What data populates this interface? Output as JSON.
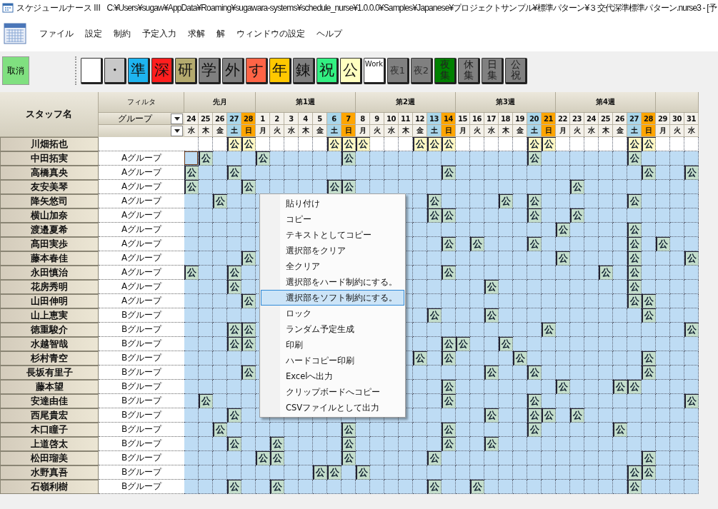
{
  "window": {
    "app_name": "スケジュールナース III",
    "file_path": "C:¥Users¥sugaw¥AppData¥Roaming¥sugawara-systems¥schedule_nurse¥1.0.0.0¥Samples¥Japanese¥プロジェクトサンプル¥標準パターン¥３交代深準標準パターン.nurse3 - [予"
  },
  "menu": [
    "ファイル",
    "設定",
    "制約",
    "予定入力",
    "求解",
    "解",
    "ウィンドウの設定",
    "ヘルプ"
  ],
  "toolbar": {
    "cancel": "取消",
    "palette": [
      {
        "kind": "single",
        "color": "#ffffff"
      },
      {
        "kind": "single",
        "label": "・",
        "color": "#c8c8c8"
      },
      {
        "kind": "single",
        "label": "準",
        "color": "#1eb4f0"
      },
      {
        "kind": "single",
        "label": "深",
        "color": "#ff1e1e"
      },
      {
        "kind": "single",
        "label": "研",
        "color": "#b4aa6e"
      },
      {
        "kind": "single",
        "label": "学",
        "color": "#808080"
      },
      {
        "kind": "single",
        "label": "外",
        "color": "#808080"
      },
      {
        "kind": "single",
        "label": "す",
        "color": "#ff6446"
      },
      {
        "kind": "single",
        "label": "年",
        "color": "#ffc800"
      },
      {
        "kind": "single",
        "label": "錬",
        "color": "#808080"
      },
      {
        "kind": "single",
        "label": "祝",
        "color": "#32f082"
      },
      {
        "kind": "single",
        "label": "公",
        "color": "#ffffc0"
      },
      {
        "kind": "small",
        "label": "Work",
        "color": "#ffffff"
      },
      {
        "kind": "medium",
        "label": "夜1",
        "color": "#808080"
      },
      {
        "kind": "medium",
        "label": "夜2",
        "color": "#808080"
      },
      {
        "kind": "stacked",
        "label": "夜集",
        "color": "#008000"
      },
      {
        "kind": "stacked",
        "label": "休集",
        "color": "#808080"
      },
      {
        "kind": "stacked",
        "label": "日集",
        "color": "#808080"
      },
      {
        "kind": "stacked",
        "label": "公祝",
        "color": "#808080"
      }
    ]
  },
  "grid": {
    "staff_header": "スタッフ名",
    "filter_header": "フィルタ",
    "group_filter": "グループ",
    "weeks": [
      {
        "label": "先月",
        "days": [
          {
            "date": "24",
            "weekday": "水",
            "kind": "weekday"
          },
          {
            "date": "25",
            "weekday": "木",
            "kind": "weekday"
          },
          {
            "date": "26",
            "weekday": "金",
            "kind": "weekday"
          },
          {
            "date": "27",
            "weekday": "土",
            "kind": "saturday"
          },
          {
            "date": "28",
            "weekday": "日",
            "kind": "sunday"
          }
        ]
      },
      {
        "label": "第1週",
        "days": [
          {
            "date": "1",
            "weekday": "月",
            "kind": "weekday"
          },
          {
            "date": "2",
            "weekday": "火",
            "kind": "weekday"
          },
          {
            "date": "3",
            "weekday": "水",
            "kind": "weekday"
          },
          {
            "date": "4",
            "weekday": "木",
            "kind": "weekday"
          },
          {
            "date": "5",
            "weekday": "金",
            "kind": "weekday"
          },
          {
            "date": "6",
            "weekday": "土",
            "kind": "saturday"
          },
          {
            "date": "7",
            "weekday": "日",
            "kind": "sunday"
          }
        ]
      },
      {
        "label": "第2週",
        "days": [
          {
            "date": "8",
            "weekday": "月",
            "kind": "weekday"
          },
          {
            "date": "9",
            "weekday": "火",
            "kind": "weekday"
          },
          {
            "date": "10",
            "weekday": "水",
            "kind": "weekday"
          },
          {
            "date": "11",
            "weekday": "木",
            "kind": "weekday"
          },
          {
            "date": "12",
            "weekday": "金",
            "kind": "weekday"
          },
          {
            "date": "13",
            "weekday": "土",
            "kind": "saturday"
          },
          {
            "date": "14",
            "weekday": "日",
            "kind": "sunday"
          }
        ]
      },
      {
        "label": "第3週",
        "days": [
          {
            "date": "15",
            "weekday": "月",
            "kind": "weekday"
          },
          {
            "date": "16",
            "weekday": "火",
            "kind": "weekday"
          },
          {
            "date": "17",
            "weekday": "水",
            "kind": "weekday"
          },
          {
            "date": "18",
            "weekday": "木",
            "kind": "weekday"
          },
          {
            "date": "19",
            "weekday": "金",
            "kind": "weekday"
          },
          {
            "date": "20",
            "weekday": "土",
            "kind": "saturday"
          },
          {
            "date": "21",
            "weekday": "日",
            "kind": "sunday"
          }
        ]
      },
      {
        "label": "第4週",
        "days": [
          {
            "date": "22",
            "weekday": "月",
            "kind": "weekday"
          },
          {
            "date": "23",
            "weekday": "火",
            "kind": "weekday"
          },
          {
            "date": "24",
            "weekday": "水",
            "kind": "weekday"
          },
          {
            "date": "25",
            "weekday": "木",
            "kind": "weekday"
          },
          {
            "date": "26",
            "weekday": "金",
            "kind": "weekday"
          },
          {
            "date": "27",
            "weekday": "土",
            "kind": "saturday"
          },
          {
            "date": "28",
            "weekday": "日",
            "kind": "sunday"
          }
        ]
      },
      {
        "days": [
          {
            "date": "29",
            "weekday": "月",
            "kind": "weekday"
          },
          {
            "date": "30",
            "weekday": "火",
            "kind": "weekday"
          },
          {
            "date": "31",
            "weekday": "水",
            "kind": "weekday"
          }
        ]
      }
    ],
    "rows": [
      {
        "kind": "preset",
        "name": "川畑拓也",
        "cells": [
          null,
          null,
          null,
          "公",
          "公",
          null,
          null,
          null,
          null,
          null,
          "公",
          "公",
          "公",
          null,
          null,
          null,
          "公",
          "公",
          "公",
          null,
          null,
          null,
          null,
          null,
          "公",
          "公",
          null,
          null,
          null,
          null,
          null,
          "公",
          "公",
          null,
          null,
          null
        ]
      },
      {
        "kind": "staff",
        "name": "中田拓実",
        "group": "Aグループ",
        "cells": [
          {
            "selected": true
          },
          "公",
          null,
          null,
          null,
          "公",
          null,
          null,
          null,
          null,
          null,
          "公",
          null,
          null,
          null,
          null,
          null,
          null,
          null,
          null,
          null,
          null,
          null,
          null,
          "公",
          null,
          null,
          null,
          null,
          null,
          null,
          "公",
          null,
          null,
          null,
          null
        ]
      },
      {
        "kind": "staff",
        "name": "高橋真央",
        "group": "Aグループ",
        "cells": [
          "公",
          null,
          null,
          "公",
          null,
          null,
          null,
          null,
          null,
          null,
          null,
          null,
          null,
          null,
          null,
          null,
          null,
          null,
          "公",
          null,
          null,
          null,
          null,
          null,
          null,
          null,
          null,
          null,
          null,
          null,
          null,
          null,
          "公",
          null,
          null,
          "公"
        ]
      },
      {
        "kind": "staff",
        "name": "友安美琴",
        "group": "Aグループ",
        "cells": [
          "公",
          null,
          null,
          null,
          "公",
          null,
          null,
          null,
          null,
          null,
          "公",
          "公",
          null,
          null,
          null,
          null,
          null,
          null,
          null,
          null,
          null,
          null,
          null,
          null,
          null,
          null,
          null,
          "公",
          null,
          null,
          null,
          null,
          null,
          null,
          null,
          null
        ]
      },
      {
        "kind": "staff",
        "name": "降矢悠司",
        "group": "Aグループ",
        "cells": [
          null,
          null,
          "公",
          null,
          null,
          null,
          null,
          null,
          null,
          null,
          null,
          null,
          null,
          null,
          null,
          null,
          null,
          "公",
          null,
          null,
          null,
          null,
          "公",
          null,
          "公",
          null,
          null,
          null,
          null,
          null,
          null,
          "公",
          null,
          null,
          null,
          null
        ]
      },
      {
        "kind": "staff",
        "name": "横山加奈",
        "group": "Aグループ",
        "cells": [
          null,
          null,
          null,
          null,
          null,
          null,
          null,
          null,
          null,
          null,
          null,
          null,
          null,
          null,
          null,
          null,
          null,
          "公",
          "公",
          null,
          null,
          null,
          null,
          null,
          "公",
          null,
          null,
          "公",
          null,
          null,
          null,
          null,
          null,
          null,
          null,
          null
        ]
      },
      {
        "kind": "staff",
        "name": "渡邉夏希",
        "group": "Aグループ",
        "cells": [
          null,
          null,
          null,
          null,
          null,
          null,
          null,
          null,
          null,
          null,
          null,
          null,
          null,
          null,
          null,
          null,
          null,
          null,
          null,
          null,
          null,
          null,
          null,
          null,
          null,
          null,
          "公",
          null,
          null,
          null,
          null,
          "公",
          null,
          null,
          null,
          null
        ]
      },
      {
        "kind": "staff",
        "name": "髙田実歩",
        "group": "Aグループ",
        "cells": [
          null,
          null,
          null,
          null,
          null,
          null,
          null,
          null,
          null,
          null,
          null,
          null,
          null,
          null,
          null,
          null,
          null,
          null,
          "公",
          null,
          "公",
          null,
          null,
          null,
          "公",
          null,
          null,
          null,
          null,
          null,
          null,
          "公",
          null,
          "公",
          null,
          null
        ]
      },
      {
        "kind": "staff",
        "name": "藤本春佳",
        "group": "Aグループ",
        "cells": [
          null,
          null,
          null,
          null,
          "公",
          null,
          null,
          null,
          null,
          null,
          null,
          null,
          null,
          null,
          null,
          null,
          null,
          null,
          null,
          null,
          null,
          null,
          null,
          null,
          null,
          null,
          "公",
          null,
          null,
          null,
          null,
          "公",
          null,
          null,
          null,
          "公"
        ]
      },
      {
        "kind": "staff",
        "name": "永田慎治",
        "group": "Aグループ",
        "cells": [
          "公",
          null,
          null,
          "公",
          null,
          null,
          null,
          null,
          null,
          null,
          null,
          null,
          null,
          null,
          null,
          null,
          null,
          null,
          "公",
          null,
          null,
          null,
          null,
          null,
          null,
          null,
          null,
          null,
          null,
          "公",
          null,
          "公",
          null,
          null,
          null,
          null
        ]
      },
      {
        "kind": "staff",
        "name": "花房秀明",
        "group": "Aグループ",
        "cells": [
          null,
          null,
          null,
          "公",
          null,
          null,
          null,
          null,
          null,
          null,
          null,
          null,
          null,
          null,
          null,
          null,
          null,
          null,
          null,
          null,
          null,
          "公",
          null,
          null,
          null,
          null,
          null,
          null,
          null,
          null,
          null,
          "公",
          null,
          null,
          null,
          null
        ]
      },
      {
        "kind": "staff",
        "name": "山田伸明",
        "group": "Aグループ",
        "cells": [
          null,
          null,
          null,
          null,
          "公",
          null,
          null,
          null,
          null,
          null,
          null,
          null,
          null,
          null,
          null,
          null,
          null,
          null,
          null,
          null,
          null,
          null,
          null,
          null,
          null,
          null,
          null,
          null,
          null,
          null,
          null,
          "公",
          "公",
          null,
          null,
          null
        ]
      },
      {
        "kind": "staff",
        "name": "山上恵実",
        "group": "Bグループ",
        "cells": [
          null,
          null,
          null,
          null,
          null,
          null,
          null,
          null,
          null,
          null,
          null,
          null,
          null,
          null,
          null,
          null,
          null,
          "公",
          null,
          null,
          null,
          "公",
          null,
          null,
          null,
          null,
          null,
          null,
          null,
          null,
          null,
          null,
          "公",
          null,
          null,
          null
        ]
      },
      {
        "kind": "staff",
        "name": "徳重駿介",
        "group": "Bグループ",
        "cells": [
          null,
          null,
          null,
          "公",
          "公",
          null,
          null,
          null,
          null,
          null,
          null,
          null,
          null,
          null,
          null,
          null,
          null,
          null,
          null,
          null,
          null,
          null,
          null,
          null,
          null,
          "公",
          null,
          null,
          null,
          null,
          null,
          null,
          null,
          null,
          null,
          "公"
        ]
      },
      {
        "kind": "staff",
        "name": "水越智哉",
        "group": "Bグループ",
        "cells": [
          null,
          null,
          null,
          "公",
          "公",
          null,
          null,
          null,
          null,
          null,
          null,
          null,
          null,
          null,
          null,
          null,
          null,
          null,
          "公",
          "公",
          null,
          null,
          "公",
          null,
          null,
          null,
          null,
          null,
          null,
          null,
          null,
          null,
          null,
          null,
          null,
          null
        ]
      },
      {
        "kind": "staff",
        "name": "杉村青空",
        "group": "Bグループ",
        "cells": [
          null,
          null,
          null,
          null,
          null,
          null,
          null,
          null,
          null,
          null,
          null,
          null,
          null,
          null,
          null,
          null,
          "公",
          null,
          "公",
          null,
          null,
          null,
          null,
          "公",
          null,
          null,
          null,
          null,
          null,
          null,
          null,
          null,
          "公",
          null,
          null,
          null
        ]
      },
      {
        "kind": "staff",
        "name": "長坂有里子",
        "group": "Bグループ",
        "cells": [
          null,
          null,
          null,
          null,
          "公",
          null,
          null,
          null,
          null,
          null,
          null,
          null,
          null,
          null,
          null,
          null,
          null,
          null,
          null,
          null,
          null,
          "公",
          null,
          null,
          "公",
          null,
          null,
          null,
          null,
          null,
          null,
          null,
          "公",
          null,
          null,
          null
        ]
      },
      {
        "kind": "staff",
        "name": "藤本望",
        "group": "Bグループ",
        "cells": [
          null,
          null,
          null,
          null,
          null,
          null,
          null,
          null,
          null,
          null,
          null,
          null,
          null,
          null,
          null,
          null,
          null,
          null,
          "公",
          null,
          null,
          null,
          null,
          null,
          null,
          null,
          "公",
          null,
          null,
          null,
          "公",
          "公",
          null,
          null,
          null,
          null
        ]
      },
      {
        "kind": "staff",
        "name": "安達由佳",
        "group": "Bグループ",
        "cells": [
          null,
          "公",
          null,
          null,
          null,
          null,
          null,
          null,
          null,
          null,
          null,
          null,
          null,
          null,
          null,
          null,
          null,
          null,
          "公",
          null,
          null,
          null,
          null,
          null,
          "公",
          null,
          null,
          null,
          null,
          null,
          null,
          null,
          null,
          null,
          null,
          "公"
        ]
      },
      {
        "kind": "staff",
        "name": "西尾貴宏",
        "group": "Bグループ",
        "cells": [
          null,
          null,
          null,
          "公",
          null,
          null,
          null,
          null,
          null,
          null,
          null,
          null,
          null,
          null,
          null,
          null,
          null,
          null,
          null,
          null,
          null,
          "公",
          null,
          null,
          "公",
          "公",
          null,
          "公",
          null,
          null,
          null,
          null,
          null,
          null,
          null,
          null
        ]
      },
      {
        "kind": "staff",
        "name": "木口瞳子",
        "group": "Bグループ",
        "cells": [
          null,
          null,
          "公",
          null,
          null,
          null,
          null,
          null,
          null,
          null,
          null,
          "公",
          null,
          null,
          null,
          null,
          null,
          null,
          "公",
          null,
          null,
          null,
          null,
          null,
          "公",
          null,
          null,
          null,
          null,
          null,
          "公",
          null,
          null,
          null,
          null,
          null
        ]
      },
      {
        "kind": "staff",
        "name": "上道啓太",
        "group": "Bグループ",
        "cells": [
          null,
          null,
          null,
          "公",
          null,
          null,
          "公",
          null,
          null,
          null,
          null,
          "公",
          null,
          null,
          null,
          null,
          null,
          null,
          "公",
          null,
          null,
          "公",
          null,
          null,
          null,
          null,
          null,
          null,
          null,
          null,
          null,
          null,
          null,
          null,
          null,
          null
        ]
      },
      {
        "kind": "staff",
        "name": "松田瑠美",
        "group": "Bグループ",
        "cells": [
          null,
          null,
          null,
          null,
          null,
          "公",
          "公",
          null,
          null,
          null,
          null,
          "公",
          null,
          null,
          null,
          null,
          null,
          "公",
          null,
          null,
          null,
          null,
          null,
          null,
          null,
          null,
          null,
          null,
          null,
          null,
          null,
          null,
          "公",
          null,
          null,
          null
        ]
      },
      {
        "kind": "staff",
        "name": "水野真吾",
        "group": "Bグループ",
        "cells": [
          null,
          null,
          null,
          null,
          null,
          null,
          null,
          null,
          null,
          "公",
          "公",
          null,
          "公",
          null,
          null,
          null,
          null,
          null,
          null,
          null,
          null,
          null,
          null,
          null,
          null,
          null,
          null,
          null,
          null,
          null,
          null,
          "公",
          "公",
          null,
          null,
          null
        ]
      },
      {
        "kind": "staff",
        "name": "石嶺利樹",
        "group": "Bグループ",
        "cells": [
          null,
          null,
          null,
          "公",
          null,
          null,
          "公",
          null,
          null,
          null,
          null,
          null,
          null,
          null,
          null,
          null,
          null,
          "公",
          null,
          null,
          "公",
          null,
          null,
          null,
          null,
          null,
          null,
          null,
          null,
          null,
          null,
          "公",
          null,
          null,
          null,
          null
        ]
      }
    ]
  },
  "context_menu": [
    {
      "label": "貼り付け",
      "selected": false
    },
    {
      "label": "コピー",
      "selected": false
    },
    {
      "label": "テキストとしてコピー",
      "selected": false
    },
    {
      "label": "選択部をクリア",
      "selected": false
    },
    {
      "label": "全クリア",
      "selected": false
    },
    {
      "label": "選択部をハード制約にする。",
      "selected": false
    },
    {
      "label": "選択部をソフト制約にする。",
      "selected": true
    },
    {
      "label": "ロック",
      "selected": false
    },
    {
      "label": "ランダム予定生成",
      "selected": false
    },
    {
      "label": "印刷",
      "selected": false
    },
    {
      "label": "ハードコピー印刷",
      "selected": false
    },
    {
      "label": "Excelへ出力",
      "selected": false
    },
    {
      "label": "クリップボードへコピー",
      "selected": false
    },
    {
      "label": "CSVファイルとして出力",
      "selected": false
    }
  ]
}
